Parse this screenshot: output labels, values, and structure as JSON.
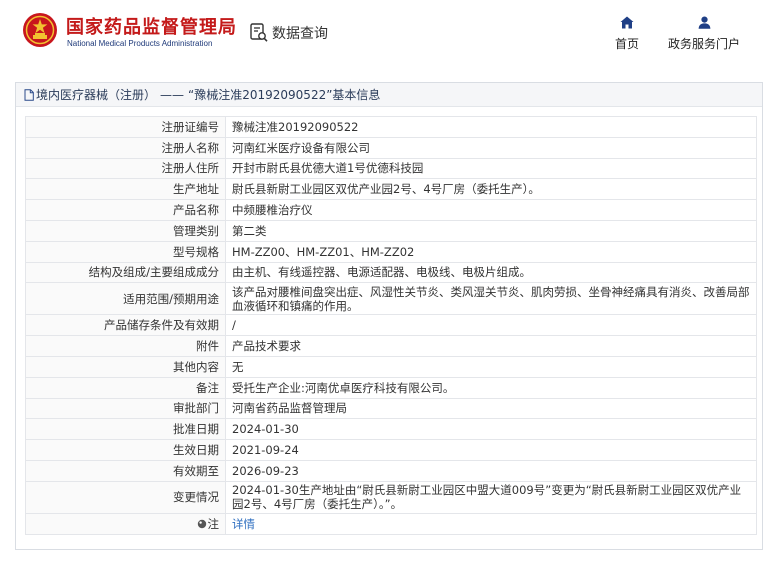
{
  "header": {
    "brand_cn": "国家药品监督管理局",
    "brand_en": "National Medical Products Administration",
    "query_label": "数据查询",
    "nav": [
      {
        "label": "首页",
        "icon": "home-icon"
      },
      {
        "label": "政务服务门户",
        "icon": "user-icon"
      }
    ]
  },
  "panel": {
    "category": "境内医疗器械（注册）",
    "separator": "——",
    "title_rest": "“豫械注准20192090522”基本信息"
  },
  "rows": [
    {
      "label": "注册证编号",
      "value": "豫械注准20192090522"
    },
    {
      "label": "注册人名称",
      "value": "河南红米医疗设备有限公司"
    },
    {
      "label": "注册人住所",
      "value": "开封市尉氏县优德大道1号优德科技园"
    },
    {
      "label": "生产地址",
      "value": "尉氏县新尉工业园区双优产业园2号、4号厂房（委托生产）。"
    },
    {
      "label": "产品名称",
      "value": "中频腰椎治疗仪"
    },
    {
      "label": "管理类别",
      "value": "第二类"
    },
    {
      "label": "型号规格",
      "value": "HM-ZZ00、HM-ZZ01、HM-ZZ02"
    },
    {
      "label": "结构及组成/主要组成成分",
      "value": "由主机、有线遥控器、电源适配器、电极线、电极片组成。"
    },
    {
      "label": "适用范围/预期用途",
      "value": "该产品对腰椎间盘突出症、风湿性关节炎、类风湿关节炎、肌肉劳损、坐骨神经痛具有消炎、改善局部血液循环和镇痛的作用。"
    },
    {
      "label": "产品储存条件及有效期",
      "value": "/"
    },
    {
      "label": "附件",
      "value": "产品技术要求"
    },
    {
      "label": "其他内容",
      "value": "无"
    },
    {
      "label": "备注",
      "value": "受托生产企业:河南优卓医疗科技有限公司。"
    },
    {
      "label": "审批部门",
      "value": "河南省药品监督管理局"
    },
    {
      "label": "批准日期",
      "value": "2024-01-30"
    },
    {
      "label": "生效日期",
      "value": "2021-09-24"
    },
    {
      "label": "有效期至",
      "value": "2026-09-23"
    },
    {
      "label": "变更情况",
      "value": "2024-01-30生产地址由“尉氏县新尉工业园区中盟大道009号”变更为“尉氏县新尉工业园区双优产业园2号、4号厂房（委托生产）。”。"
    },
    {
      "label": "注",
      "value": "详情"
    }
  ]
}
